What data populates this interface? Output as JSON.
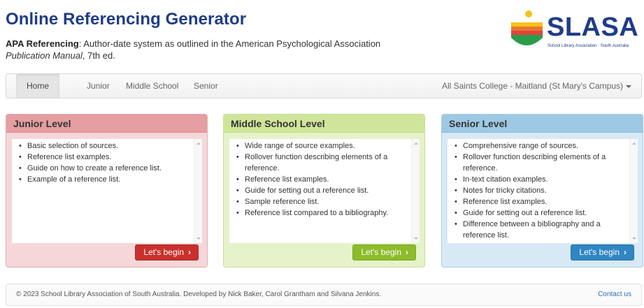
{
  "header": {
    "title": "Online Referencing Generator",
    "subtitle_bold": "APA Referencing",
    "subtitle_text": ": Author-date system as outlined in the American Psychological Association ",
    "subtitle_italic": "Publication Manual",
    "subtitle_end": ", 7th ed."
  },
  "logo": {
    "word": "SLASA",
    "tagline": "School Library Association · South Australia",
    "colors": {
      "yellow": "#f6c21b",
      "orange": "#e8772e",
      "red": "#e0443b",
      "green": "#2a9d4a",
      "navy": "#1f3c88"
    }
  },
  "nav": {
    "items": [
      "Home",
      "Junior",
      "Middle School",
      "Senior"
    ],
    "active": "Home",
    "school": "All Saints College - Maitland (St Mary's Campus)"
  },
  "panels": {
    "junior": {
      "title": "Junior Level",
      "items": [
        "Basic selection of sources.",
        "Reference list examples.",
        "Guide on how to create a reference list.",
        "Example of a reference list."
      ],
      "button": "Let's begin"
    },
    "middle": {
      "title": "Middle School Level",
      "items": [
        "Wide range of source examples.",
        "Rollover function describing elements of a reference.",
        "Reference list examples.",
        "Guide for setting out a reference list.",
        "Sample reference list.",
        "Reference list compared to a bibliography."
      ],
      "button": "Let's begin"
    },
    "senior": {
      "title": "Senior Level",
      "items": [
        "Comprehensive range of sources.",
        "Rollover function describing elements of a reference.",
        "In-text citation examples.",
        "Notes for tricky citations.",
        "Reference list examples.",
        "Guide for setting out a reference list.",
        "Difference between a bibliography and a reference list."
      ],
      "button": "Let's begin"
    }
  },
  "footer": {
    "text": "© 2023 School Library Association of South Australia. Developed by Nick Baker, Carol Grantham and Silvana Jenkins.",
    "contact": "Contact us"
  }
}
